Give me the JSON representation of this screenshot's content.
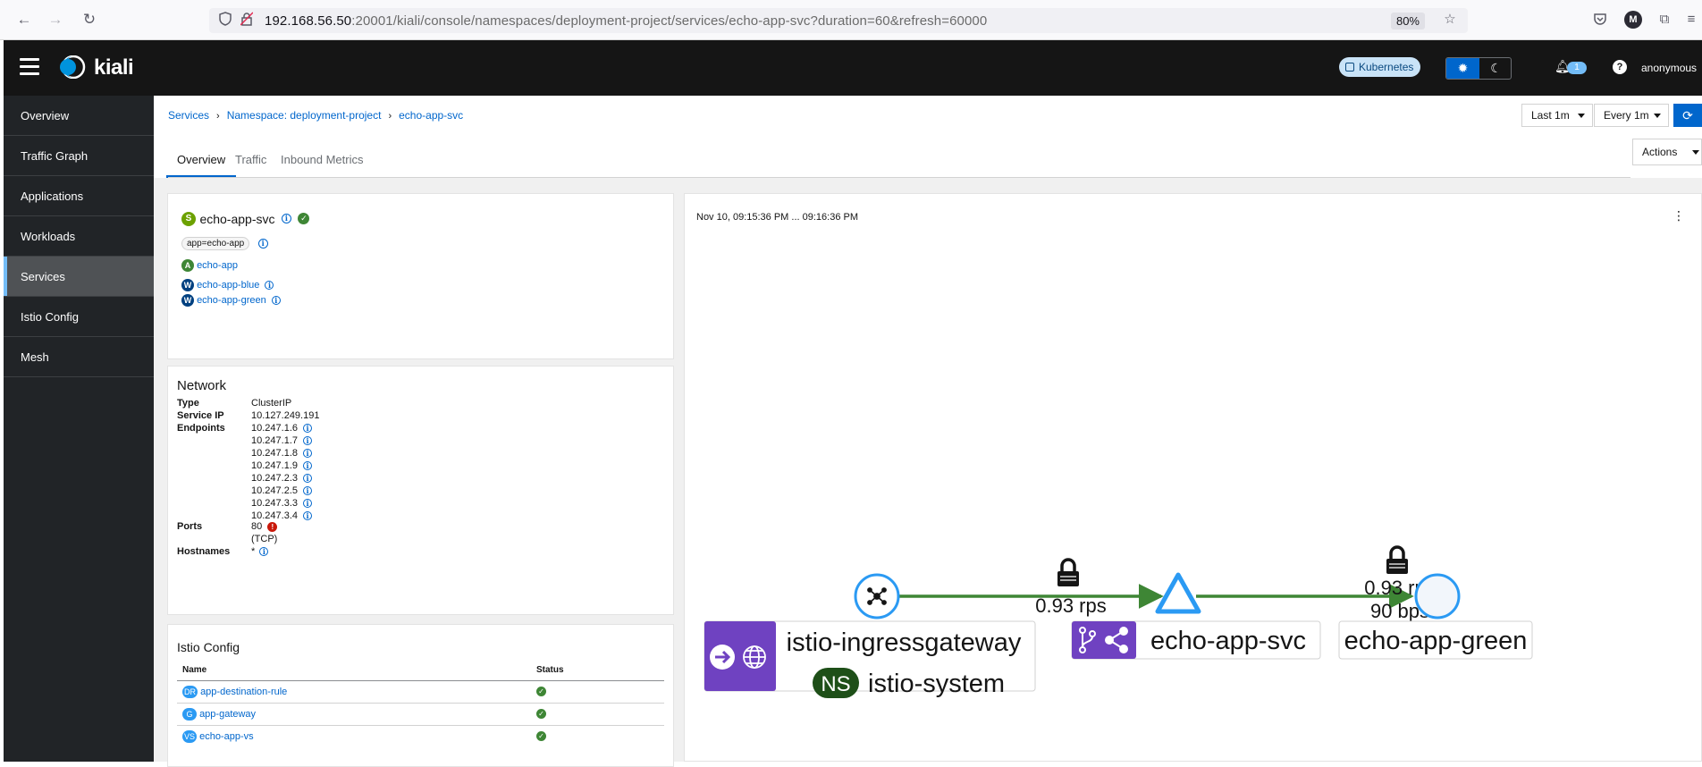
{
  "browser": {
    "url_host": "192.168.56.50",
    "url_path": ":20001/kiali/console/namespaces/deployment-project/services/echo-app-svc?duration=60&refresh=60000",
    "zoom": "80%",
    "profile_initial": "M"
  },
  "masthead": {
    "brand": "kiali",
    "cluster_badge": "Kubernetes",
    "notification_count": "1",
    "user": "anonymous"
  },
  "sidebar": {
    "items": [
      {
        "label": "Overview",
        "active": false
      },
      {
        "label": "Traffic Graph",
        "active": false
      },
      {
        "label": "Applications",
        "active": false
      },
      {
        "label": "Workloads",
        "active": false
      },
      {
        "label": "Services",
        "active": true
      },
      {
        "label": "Istio Config",
        "active": false
      },
      {
        "label": "Mesh",
        "active": false
      }
    ]
  },
  "breadcrumb": {
    "items": [
      "Services",
      "Namespace: deployment-project",
      "echo-app-svc"
    ]
  },
  "toolbar": {
    "range": "Last 1m",
    "refresh": "Every 1m",
    "actions": "Actions"
  },
  "tabs": [
    "Overview",
    "Traffic",
    "Inbound Metrics"
  ],
  "service": {
    "badge": "S",
    "name": "echo-app-svc",
    "label": "app=echo-app",
    "app": {
      "badge": "A",
      "name": "echo-app"
    },
    "workloads": [
      {
        "badge": "W",
        "name": "echo-app-blue"
      },
      {
        "badge": "W",
        "name": "echo-app-green"
      }
    ]
  },
  "network": {
    "title": "Network",
    "type_label": "Type",
    "type": "ClusterIP",
    "ip_label": "Service IP",
    "ip": "10.127.249.191",
    "endpoints_label": "Endpoints",
    "endpoints": [
      "10.247.1.6",
      "10.247.1.7",
      "10.247.1.8",
      "10.247.1.9",
      "10.247.2.3",
      "10.247.2.5",
      "10.247.3.3",
      "10.247.3.4"
    ],
    "ports_label": "Ports",
    "port": "80",
    "protocol": "(TCP)",
    "hostnames_label": "Hostnames",
    "hostnames": "*"
  },
  "istio_config": {
    "title": "Istio Config",
    "col_name": "Name",
    "col_status": "Status",
    "rows": [
      {
        "badge": "DR",
        "name": "app-destination-rule"
      },
      {
        "badge": "G",
        "name": "app-gateway"
      },
      {
        "badge": "VS",
        "name": "echo-app-vs"
      }
    ]
  },
  "graph": {
    "time_range": "Nov 10, 09:15:36 PM ... 09:16:36 PM",
    "nodes": [
      {
        "name": "istio-ingressgateway",
        "namespace_badge": "NS",
        "namespace": "istio-system"
      },
      {
        "name": "echo-app-svc"
      },
      {
        "name": "echo-app-green"
      }
    ],
    "edges": [
      {
        "rate": "0.93 rps"
      },
      {
        "rate": "0.93 rps",
        "throughput": "90 bps"
      }
    ]
  },
  "colors": {
    "accent": "#0066cc",
    "edge": "#3e8635",
    "node_label_bg": "#6f42c1",
    "masthead": "#151515",
    "sidebar": "#212427"
  }
}
